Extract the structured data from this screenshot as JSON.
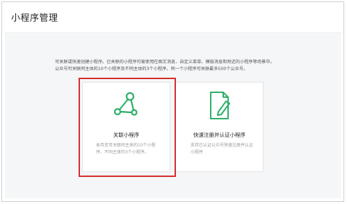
{
  "page": {
    "title": "小程序管理"
  },
  "intro": {
    "line1": "可关联或快速创建小程序。已关联的小程序可被使用在图文消息、自定义菜单、模版消息和附近的小程序等场景中。",
    "line2": "公众号可关联同主体的10个小程序及不同主体的3个小程序，同一个小程序可关联最多500个公众号。"
  },
  "cards": [
    {
      "icon": "link-nodes-icon",
      "title": "关联小程序",
      "desc_line1": "本月还可关联同主体的10个小程",
      "desc_line2": "序、不同主体的3个小程序。",
      "highlighted": true
    },
    {
      "icon": "document-pen-icon",
      "title": "快速注册并认证小程序",
      "desc_line1": "支持已认证公众号快速注册并认证",
      "desc_line2": "小程序"
    }
  ],
  "colors": {
    "accent_green": "#2aae67",
    "highlight_red": "#d62a2a"
  }
}
